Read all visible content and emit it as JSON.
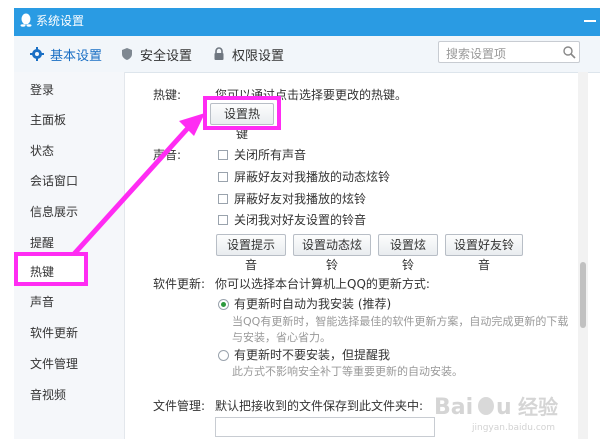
{
  "window": {
    "title": "系统设置"
  },
  "tabs": [
    {
      "label": "基本设置",
      "icon": "gear-icon"
    },
    {
      "label": "安全设置",
      "icon": "shield-icon"
    },
    {
      "label": "权限设置",
      "icon": "lock-icon"
    }
  ],
  "search": {
    "placeholder": "搜索设置项"
  },
  "sidebar": {
    "items": [
      {
        "label": "登录"
      },
      {
        "label": "主面板"
      },
      {
        "label": "状态"
      },
      {
        "label": "会话窗口"
      },
      {
        "label": "信息展示"
      },
      {
        "label": "提醒"
      },
      {
        "label": "热键"
      },
      {
        "label": "声音"
      },
      {
        "label": "软件更新"
      },
      {
        "label": "文件管理"
      },
      {
        "label": "音视频"
      }
    ]
  },
  "hotkey": {
    "title": "热键:",
    "desc": "您可以通过点击选择要更改的热键。",
    "button": "设置热键"
  },
  "sound": {
    "title": "声音:",
    "options": [
      "关闭所有声音",
      "屏蔽好友对我播放的动态炫铃",
      "屏蔽好友对我播放的炫铃",
      "关闭我对好友设置的铃音"
    ],
    "buttons": [
      "设置提示音",
      "设置动态炫铃",
      "设置炫铃",
      "设置好友铃音"
    ]
  },
  "update": {
    "title": "软件更新:",
    "desc": "你可以选择本台计算机上QQ的更新方式:",
    "option1": "有更新时自动为我安装 (推荐)",
    "option1_desc_1": "当QQ有更新时，智能选择最佳的软件更新方案，自动完成更新的下载",
    "option1_desc_2": "与安装，省心省力。",
    "option2": "有更新时不要安装，但提醒我",
    "option2_desc": "此方式不影响安全补丁等重要更新的自动安装。"
  },
  "file": {
    "title": "文件管理:",
    "desc": "默认把接收到的文件保存到此文件夹中:"
  },
  "colors": {
    "titlebar": "#2a9be3",
    "highlight": "#ff2cf3",
    "accent": "#1a6fc4"
  }
}
